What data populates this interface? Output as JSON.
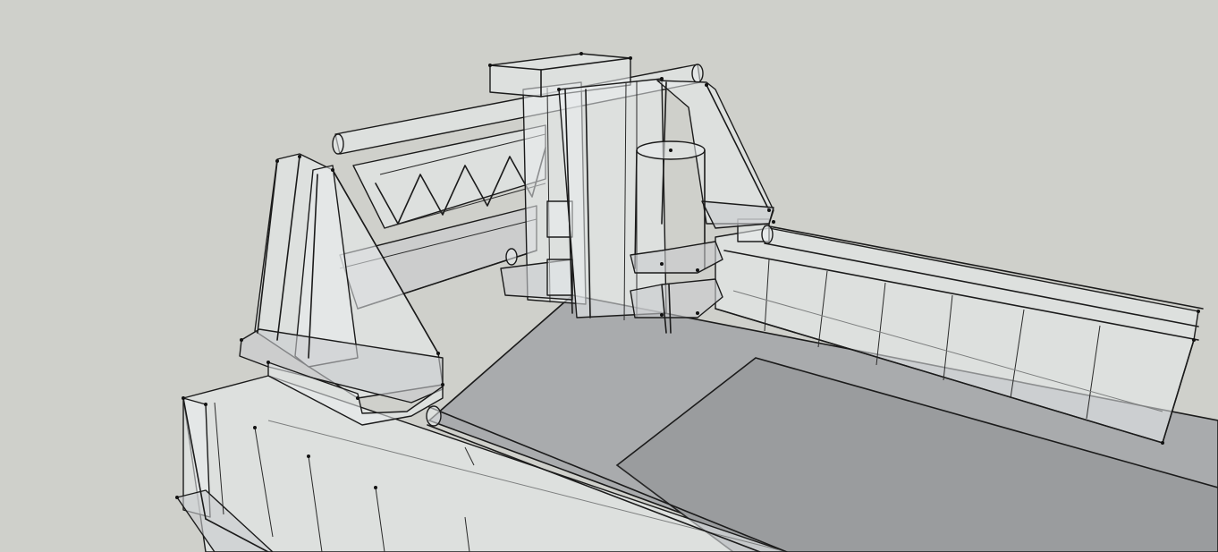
{
  "colors": {
    "background": "#cfd0cb",
    "edges": "#1b1b1b",
    "glass": "#e9ecee",
    "table": "#a9abad"
  }
}
